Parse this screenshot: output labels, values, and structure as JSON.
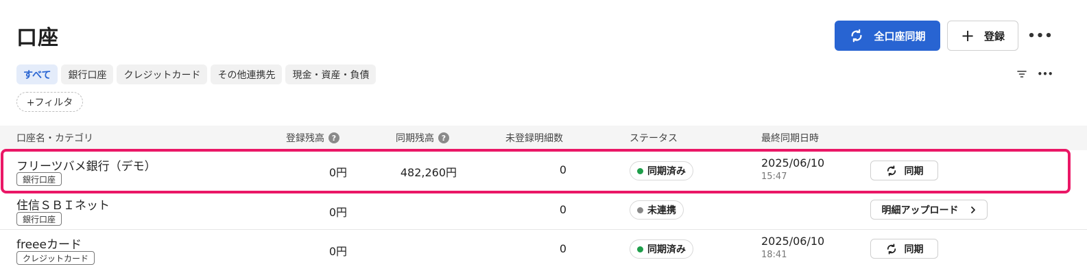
{
  "header": {
    "title": "口座",
    "sync_all_label": "全口座同期",
    "register_label": "登録",
    "more_label": "•••"
  },
  "filters": {
    "chips": [
      "すべて",
      "銀行口座",
      "クレジットカード",
      "その他連携先",
      "現金・資産・負債"
    ],
    "active_index": 0,
    "add_filter_label": "+フィルタ",
    "more_label": "•••"
  },
  "table": {
    "columns": {
      "name": "口座名・カテゴリ",
      "registered_balance": "登録残高",
      "synced_balance": "同期残高",
      "unregistered_count": "未登録明細数",
      "status": "ステータス",
      "last_sync": "最終同期日時"
    },
    "help_mark": "?",
    "rows": [
      {
        "name": "フリーツバメ銀行（デモ）",
        "category": "銀行口座",
        "registered_balance": "0円",
        "synced_balance": "482,260円",
        "unregistered_count": "0",
        "status": "同期済み",
        "last_sync_date": "2025/06/10",
        "last_sync_time": "15:47",
        "action": "同期"
      },
      {
        "name": "住信ＳＢＩネット",
        "category": "銀行口座",
        "registered_balance": "0円",
        "synced_balance": "",
        "unregistered_count": "0",
        "status": "未連携",
        "last_sync_date": "",
        "last_sync_time": "",
        "action": "明細アップロード"
      },
      {
        "name": "freeeカード",
        "category": "クレジットカード",
        "registered_balance": "0円",
        "synced_balance": "",
        "unregistered_count": "0",
        "status": "同期済み",
        "last_sync_date": "2025/06/10",
        "last_sync_time": "18:41",
        "action": "同期"
      }
    ]
  },
  "colors": {
    "primary": "#2864d2",
    "highlight": "#ea1766",
    "status_synced": "#1e9e4a",
    "status_unlinked": "#888888"
  }
}
